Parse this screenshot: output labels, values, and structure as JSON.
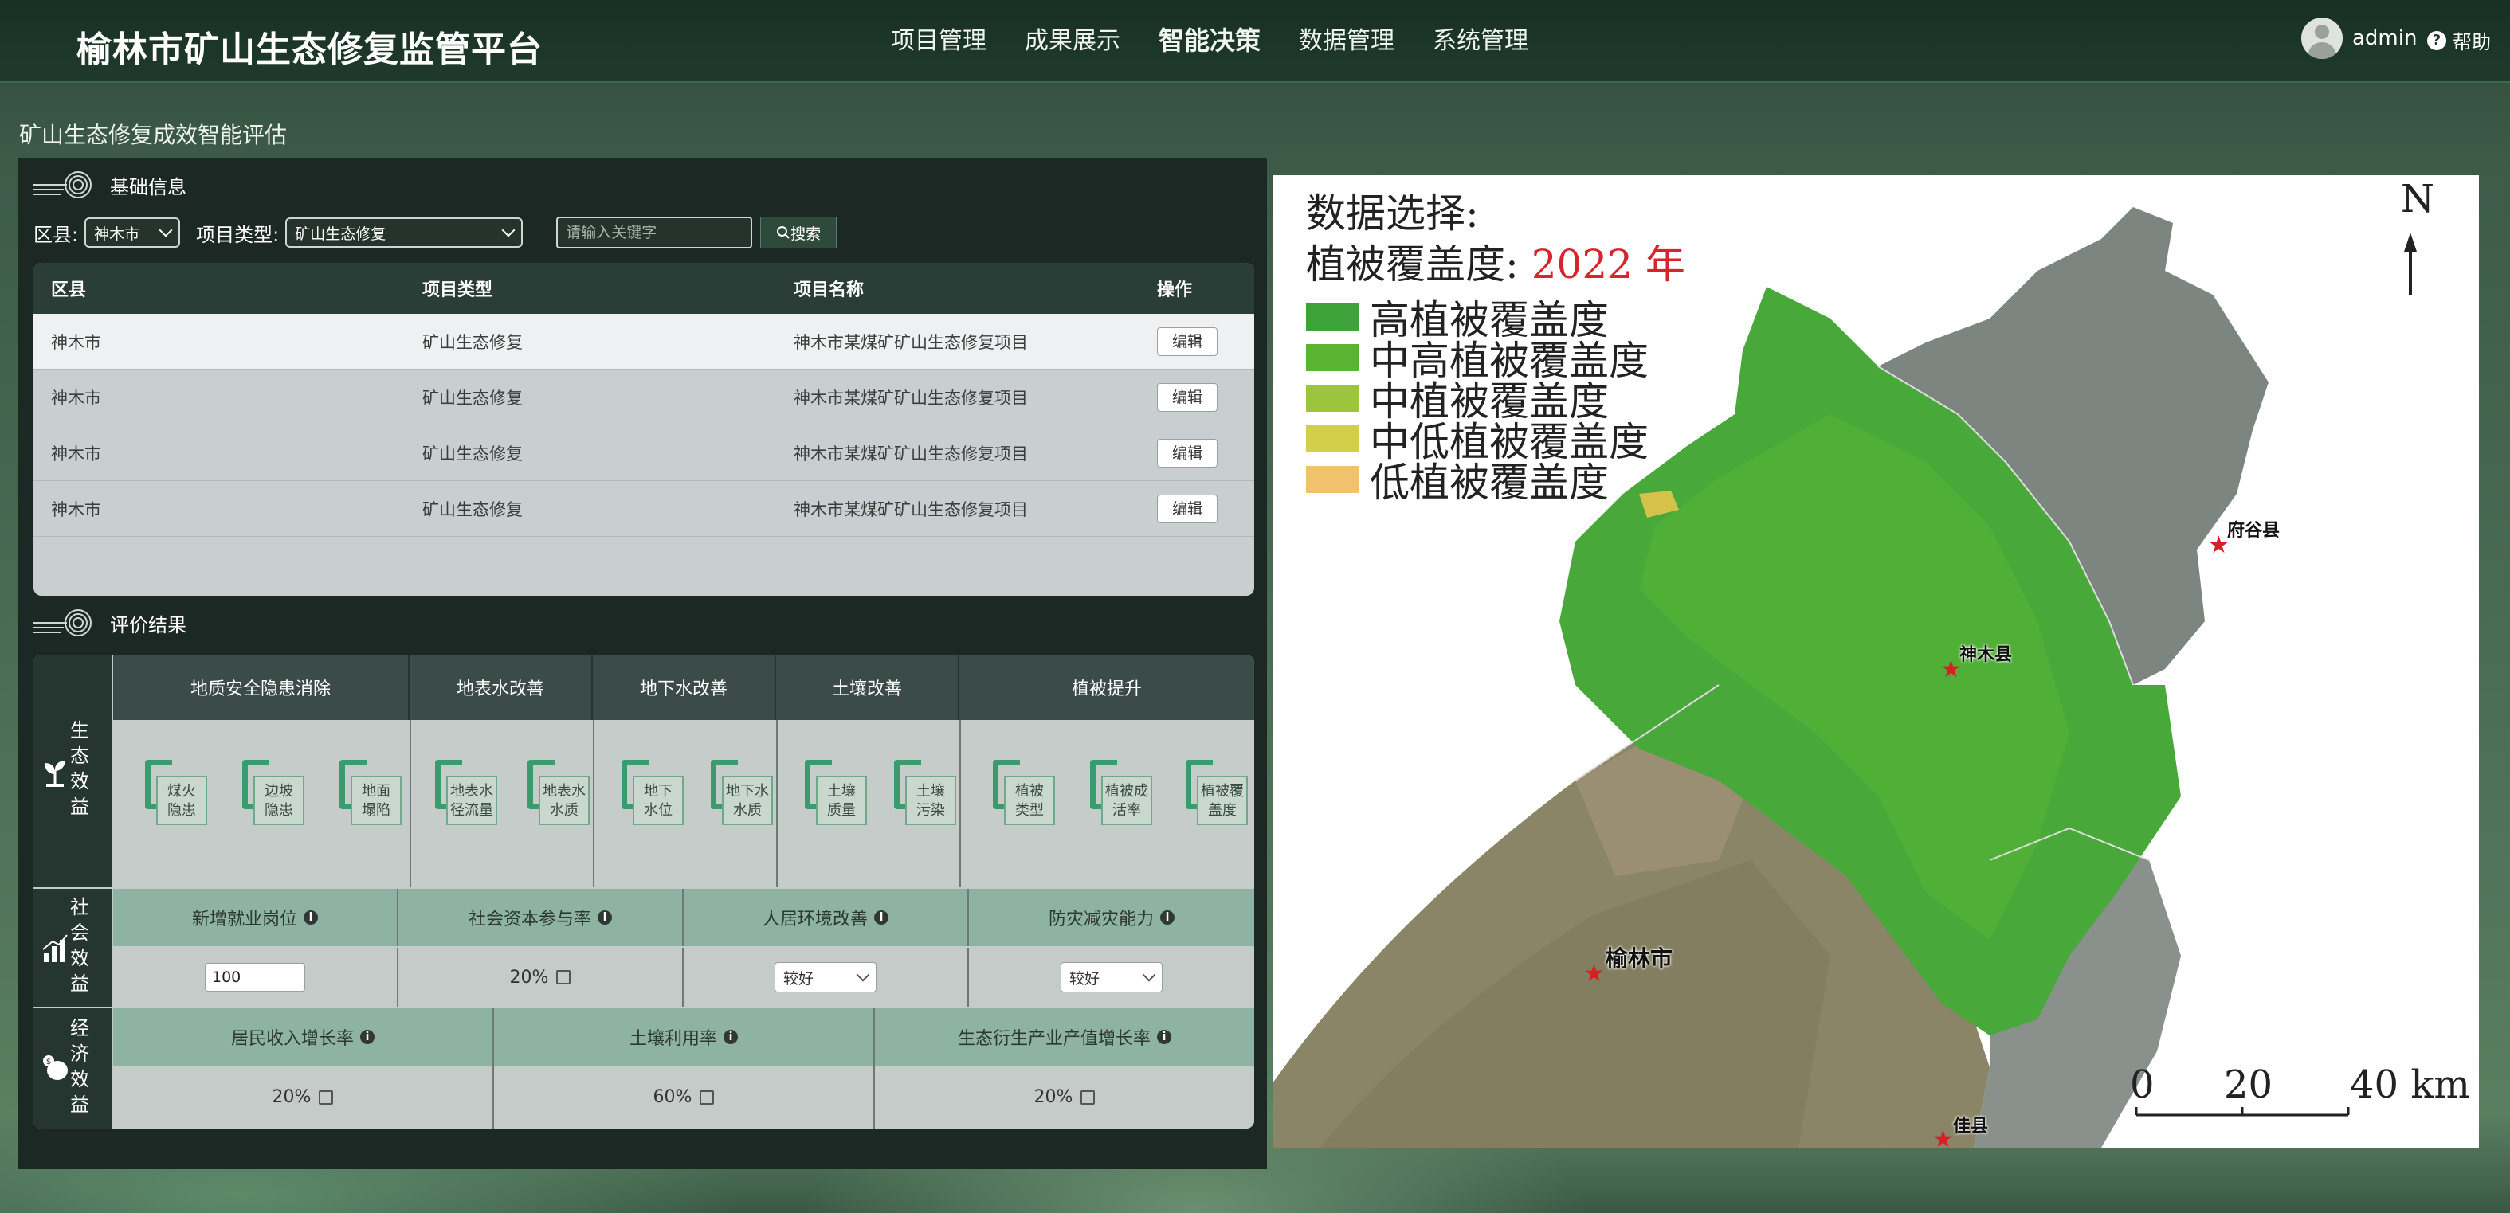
{
  "app": {
    "title": "榆林市矿山生态修复监管平台"
  },
  "nav": {
    "items": [
      "项目管理",
      "成果展示",
      "智能决策",
      "数据管理",
      "系统管理"
    ],
    "active": "智能决策"
  },
  "user": {
    "name": "admin",
    "help": "帮助"
  },
  "breadcrumb": "矿山生态修复成效智能评估",
  "basic_info": {
    "title": "基础信息",
    "filters": {
      "county_label": "区县:",
      "county_value": "神木市",
      "type_label": "项目类型:",
      "type_value": "矿山生态修复",
      "keyword_placeholder": "请输入关键字",
      "search_label": "搜索"
    },
    "table": {
      "headers": [
        "区县",
        "项目类型",
        "项目名称",
        "操作"
      ],
      "rows": [
        {
          "county": "神木市",
          "type": "矿山生态修复",
          "name": "神木市某煤矿矿山生态修复项目",
          "action": "编辑"
        },
        {
          "county": "神木市",
          "type": "矿山生态修复",
          "name": "神木市某煤矿矿山生态修复项目",
          "action": "编辑"
        },
        {
          "county": "神木市",
          "type": "矿山生态修复",
          "name": "神木市某煤矿矿山生态修复项目",
          "action": "编辑"
        },
        {
          "county": "神木市",
          "type": "矿山生态修复",
          "name": "神木市某煤矿矿山生态修复项目",
          "action": "编辑"
        }
      ]
    }
  },
  "evaluation": {
    "title": "评价结果",
    "ecological": {
      "label": "生态效益",
      "groups": [
        {
          "name": "地质安全隐患消除",
          "items": [
            [
              "煤火",
              "隐患"
            ],
            [
              "边坡",
              "隐患"
            ],
            [
              "地面",
              "塌陷"
            ]
          ]
        },
        {
          "name": "地表水改善",
          "items": [
            [
              "地表水",
              "径流量"
            ],
            [
              "地表水",
              "水质"
            ]
          ]
        },
        {
          "name": "地下水改善",
          "items": [
            [
              "地下",
              "水位"
            ],
            [
              "地下水",
              "水质"
            ]
          ]
        },
        {
          "name": "土壤改善",
          "items": [
            [
              "土壤",
              "质量"
            ],
            [
              "土壤",
              "污染"
            ]
          ]
        },
        {
          "name": "植被提升",
          "items": [
            [
              "植被",
              "类型"
            ],
            [
              "植被成",
              "活率"
            ],
            [
              "植被覆",
              "盖度"
            ]
          ]
        }
      ]
    },
    "social": {
      "label": "社会效益",
      "cols": [
        {
          "name": "新增就业岗位",
          "value": "100"
        },
        {
          "name": "社会资本参与率",
          "value": "20%"
        },
        {
          "name": "人居环境改善",
          "value": "较好"
        },
        {
          "name": "防灾减灾能力",
          "value": "较好"
        }
      ]
    },
    "economic": {
      "label": "经济效益",
      "cols": [
        {
          "name": "居民收入增长率",
          "value": "20%"
        },
        {
          "name": "土壤利用率",
          "value": "60%"
        },
        {
          "name": "生态衍生产业产值增长率",
          "value": "20%"
        }
      ]
    }
  },
  "map": {
    "title": "数据选择:",
    "year_label": "植被覆盖度: ",
    "year_value": "2022 年",
    "legend": [
      {
        "label": "高植被覆盖度",
        "color": "#3ea33a"
      },
      {
        "label": "中高植被覆盖度",
        "color": "#5bb431"
      },
      {
        "label": "中植被覆盖度",
        "color": "#9cc43c"
      },
      {
        "label": "中低植被覆盖度",
        "color": "#d4cf4b"
      },
      {
        "label": "低植被覆盖度",
        "color": "#f1c26b"
      }
    ],
    "north": "N",
    "scale": {
      "s0": "0",
      "s1": "20",
      "s2": "40 km"
    },
    "places": [
      "府谷县",
      "神木县",
      "榆林市",
      "佳县"
    ]
  }
}
